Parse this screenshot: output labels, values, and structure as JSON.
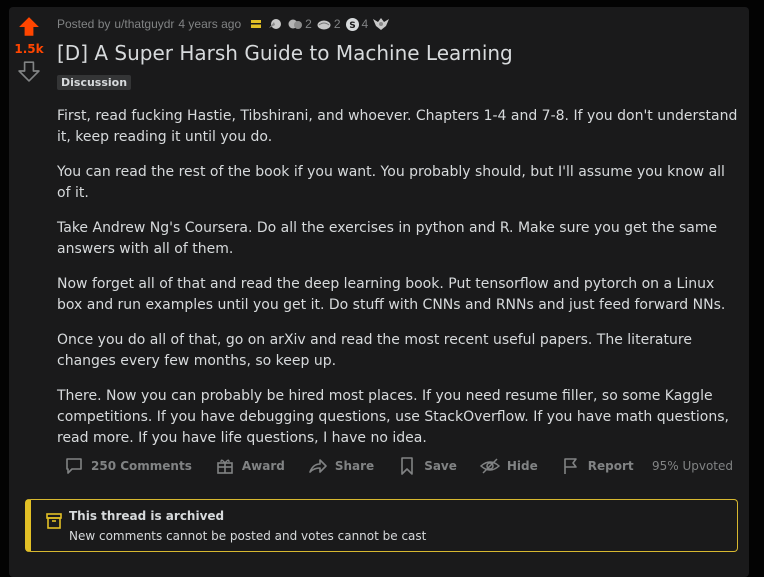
{
  "post": {
    "score": "1.5k",
    "posted_by_prefix": "Posted by",
    "author": "u/thatguydr",
    "time": "4 years ago",
    "awards": [
      {
        "icon": "silver-award-icon",
        "count": ""
      },
      {
        "icon": "helpful-award-icon",
        "count": ""
      },
      {
        "icon": "wholesome-award-icon",
        "count": "2"
      },
      {
        "icon": "brain-award-icon",
        "count": "2"
      },
      {
        "icon": "s-award-icon",
        "count": "4"
      },
      {
        "icon": "eagle-award-icon",
        "count": ""
      }
    ],
    "title": "[D] A Super Harsh Guide to Machine Learning",
    "flair": "Discussion",
    "paragraphs": [
      "First, read fucking Hastie, Tibshirani, and whoever. Chapters 1-4 and 7-8. If you don't understand it, keep reading it until you do.",
      "You can read the rest of the book if you want. You probably should, but I'll assume you know all of it.",
      "Take Andrew Ng's Coursera. Do all the exercises in python and R. Make sure you get the same answers with all of them.",
      "Now forget all of that and read the deep learning book. Put tensorflow and pytorch on a Linux box and run examples until you get it. Do stuff with CNNs and RNNs and just feed forward NNs.",
      "Once you do all of that, go on arXiv and read the most recent useful papers. The literature changes every few months, so keep up.",
      "There. Now you can probably be hired most places. If you need resume filler, so some Kaggle competitions. If you have debugging questions, use StackOverflow. If you have math questions, read more. If you have life questions, I have no idea."
    ]
  },
  "actions": {
    "comments": "250 Comments",
    "award": "Award",
    "share": "Share",
    "save": "Save",
    "hide": "Hide",
    "report": "Report",
    "upvoted": "95% Upvoted"
  },
  "archived": {
    "title": "This thread is archived",
    "message": "New comments cannot be posted and votes cannot be cast"
  },
  "colors": {
    "upvote": "#ff4500",
    "archive_border": "#e2c026"
  }
}
